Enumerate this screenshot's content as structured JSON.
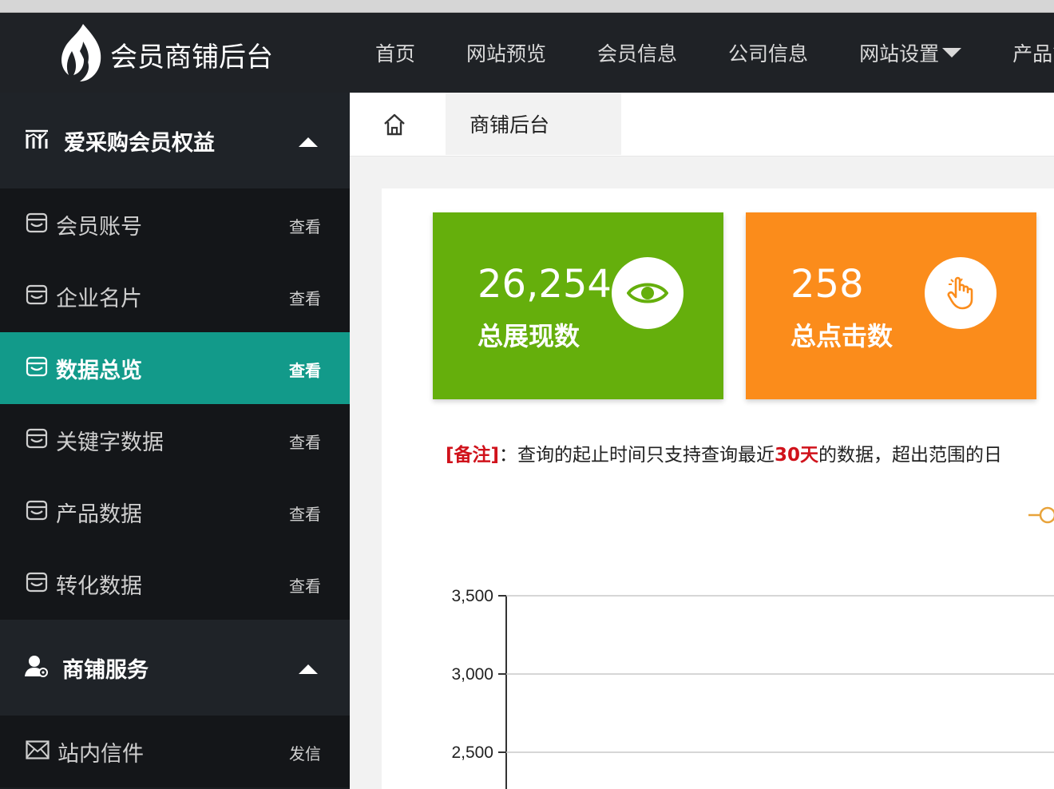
{
  "header": {
    "logo_text": "会员商铺后台",
    "nav": [
      {
        "label": "首页"
      },
      {
        "label": "网站预览"
      },
      {
        "label": "会员信息"
      },
      {
        "label": "公司信息"
      },
      {
        "label": "网站设置",
        "has_dropdown": true
      },
      {
        "label": "产品管"
      }
    ]
  },
  "sidebar": {
    "groups": [
      {
        "title": "爱采购会员权益",
        "icon": "bar-chart-icon",
        "expanded": true,
        "items": [
          {
            "label": "会员账号",
            "action": "查看",
            "icon": "store-icon",
            "active": false
          },
          {
            "label": "企业名片",
            "action": "查看",
            "icon": "store-icon",
            "active": false
          },
          {
            "label": "数据总览",
            "action": "查看",
            "icon": "store-icon",
            "active": true
          },
          {
            "label": "关键字数据",
            "action": "查看",
            "icon": "store-icon",
            "active": false
          },
          {
            "label": "产品数据",
            "action": "查看",
            "icon": "store-icon",
            "active": false
          },
          {
            "label": "转化数据",
            "action": "查看",
            "icon": "store-icon",
            "active": false
          }
        ]
      },
      {
        "title": "商铺服务",
        "icon": "user-icon",
        "expanded": true,
        "items": [
          {
            "label": "站内信件",
            "action": "发信",
            "icon": "mail-icon",
            "active": false
          }
        ]
      }
    ]
  },
  "breadcrumb": {
    "home_icon": "home-icon",
    "current": "商铺后台"
  },
  "stats": [
    {
      "value": "26,254",
      "label": "总展现数",
      "icon": "eye-icon",
      "color": "#65af0c"
    },
    {
      "value": "258",
      "label": "总点击数",
      "icon": "hand-pointer-icon",
      "color": "#fb8c1b"
    }
  ],
  "note": {
    "tag": "[备注]",
    "text_before": "：查询的起止时间只支持查询最近",
    "highlight": "30天",
    "text_after": "的数据，超出范围的日"
  },
  "chart_data": {
    "type": "line",
    "y_ticks": [
      "3,500",
      "3,000",
      "2,500"
    ],
    "y_tick_values": [
      3500,
      3000,
      2500
    ],
    "series_color": "#e8a33a",
    "ylim": [
      2500,
      3500
    ]
  },
  "colors": {
    "topbar": "#1f2226",
    "sidebar": "#1b1e22",
    "active": "#129a8a",
    "green_card": "#65af0c",
    "orange_card": "#fb8c1b",
    "highlight_red": "#d0121b"
  }
}
